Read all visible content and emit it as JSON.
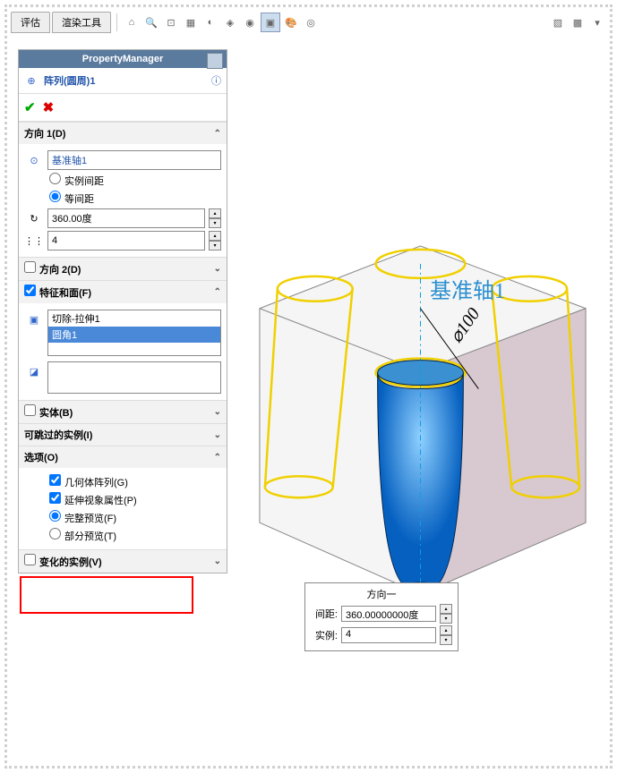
{
  "topbar": {
    "tab1": "评估",
    "tab2": "渲染工具"
  },
  "pm": {
    "title": "PropertyManager",
    "feature": "阵列(圆周)1"
  },
  "sect": {
    "dir1": "方向 1(D)",
    "axis": "基准轴1",
    "r1": "实例间距",
    "r2": "等间距",
    "angle": "360.00度",
    "count": "4",
    "dir2": "方向 2(D)",
    "feat": "特征和面(F)",
    "f1": "切除-拉伸1",
    "f2": "圆角1",
    "body": "实体(B)",
    "skip": "可跳过的实例(I)",
    "opt": "选项(O)",
    "c1": "几何体阵列(G)",
    "c2": "延伸视象属性(P)",
    "c3": "完整预览(F)",
    "c4": "部分预览(T)",
    "vary": "变化的实例(V)"
  },
  "callout": {
    "title": "方向一",
    "l1": "间距:",
    "v1": "360.00000000度",
    "l2": "实例:",
    "v2": "4"
  },
  "view": {
    "axis": "基准轴1",
    "dim": "⌀100"
  }
}
